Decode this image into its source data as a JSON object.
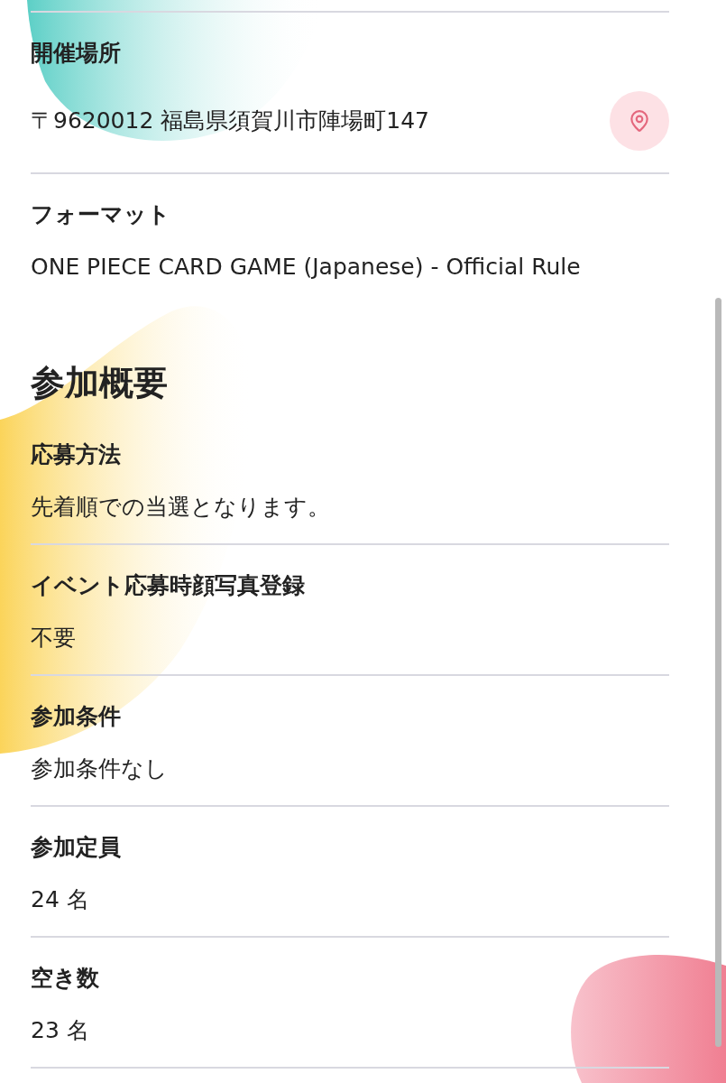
{
  "details": [
    {
      "kind": "location",
      "label": "開催場所",
      "value": "〒9620012 福島県須賀川市陣場町147"
    },
    {
      "kind": "text",
      "label": "フォーマット",
      "value": "ONE PIECE CARD GAME (Japanese) - Official Rule"
    }
  ],
  "section": {
    "title": "参加概要",
    "fields": [
      {
        "label": "応募方法",
        "value": "先着順での当選となります。"
      },
      {
        "label": "イベント応募時顔写真登録",
        "value": "不要"
      },
      {
        "label": "参加条件",
        "value": "参加条件なし"
      },
      {
        "label": "参加定員",
        "value": "24 名"
      },
      {
        "label": "空き数",
        "value": "23 名"
      }
    ]
  }
}
